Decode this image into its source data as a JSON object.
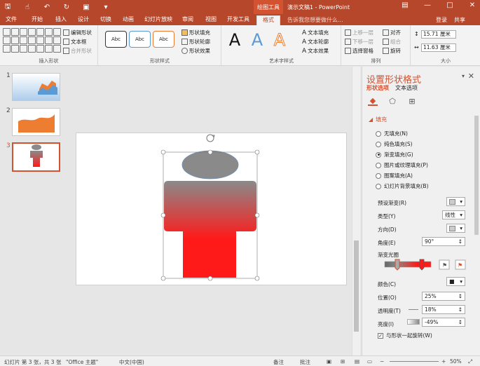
{
  "titlebar": {
    "contextual_group": "绘图工具",
    "document_title": "演示文稿1 - PowerPoint"
  },
  "tabs": [
    {
      "label": "文件"
    },
    {
      "label": "开始"
    },
    {
      "label": "插入"
    },
    {
      "label": "设计"
    },
    {
      "label": "切换"
    },
    {
      "label": "动画"
    },
    {
      "label": "幻灯片放映"
    },
    {
      "label": "审阅"
    },
    {
      "label": "视图"
    },
    {
      "label": "开发工具"
    },
    {
      "label": "格式"
    }
  ],
  "tellme": "告诉我您想要做什么...",
  "login": "登录",
  "share": "共享",
  "ribbon": {
    "insert_shapes": {
      "label": "插入形状",
      "edit_shape": "编辑形状",
      "text_box": "文本框",
      "merge_shapes": "合并形状"
    },
    "shape_styles": {
      "label": "形状样式",
      "swatch_text": "Abc",
      "fill": "形状填充",
      "outline": "形状轮廓",
      "effects": "形状效果"
    },
    "wordart": {
      "label": "艺术字样式",
      "glyph": "A",
      "text_fill": "文本填充",
      "text_outline": "文本轮廓",
      "text_effects": "文本效果"
    },
    "arrange": {
      "label": "排列",
      "bring_forward": "上移一层",
      "send_backward": "下移一层",
      "selection_pane": "选择窗格",
      "align": "对齐",
      "group": "组合",
      "rotate": "旋转"
    },
    "size": {
      "label": "大小",
      "height": "15.71 厘米",
      "width": "11.63 厘米"
    }
  },
  "slides": [
    {
      "number": "1"
    },
    {
      "number": "2"
    },
    {
      "number": "3"
    }
  ],
  "pane": {
    "title": "设置形状格式",
    "tab_shape": "形状选项",
    "tab_text": "文本选项",
    "section_fill": "填充",
    "fill_options": [
      {
        "label": "无填充(N)",
        "selected": false
      },
      {
        "label": "纯色填充(S)",
        "selected": false
      },
      {
        "label": "渐变填充(G)",
        "selected": true
      },
      {
        "label": "图片或纹理填充(P)",
        "selected": false
      },
      {
        "label": "图案填充(A)",
        "selected": false
      },
      {
        "label": "幻灯片背景填充(B)",
        "selected": false
      }
    ],
    "preset_gradient": "预设渐变(R)",
    "type_label": "类型(Y)",
    "type_value": "线性",
    "direction_label": "方向(D)",
    "angle_label": "角度(E)",
    "angle_value": "90°",
    "gradient_stops_label": "渐变光圈",
    "color_label": "颜色(C)",
    "position_label": "位置(O)",
    "position_value": "25%",
    "transparency_label": "透明度(T)",
    "transparency_value": "18%",
    "brightness_label": "亮度(I)",
    "brightness_value": "-49%",
    "rotate_with_shape": "与形状一起旋转(W)"
  },
  "status": {
    "slide_info": "幻灯片 第 3 张，共 3 张",
    "theme": "\"Office 主题\"",
    "language": "中文(中国)",
    "notes": "备注",
    "comments": "批注",
    "zoom": "50%"
  },
  "colors": {
    "accent": "#b7472a",
    "accent_light": "#d35230",
    "shape_gray": "#8a8a8a",
    "shape_red": "#ff1a1a",
    "thumb_blue": "#5b9bd5",
    "thumb_orange": "#ed7d31"
  }
}
